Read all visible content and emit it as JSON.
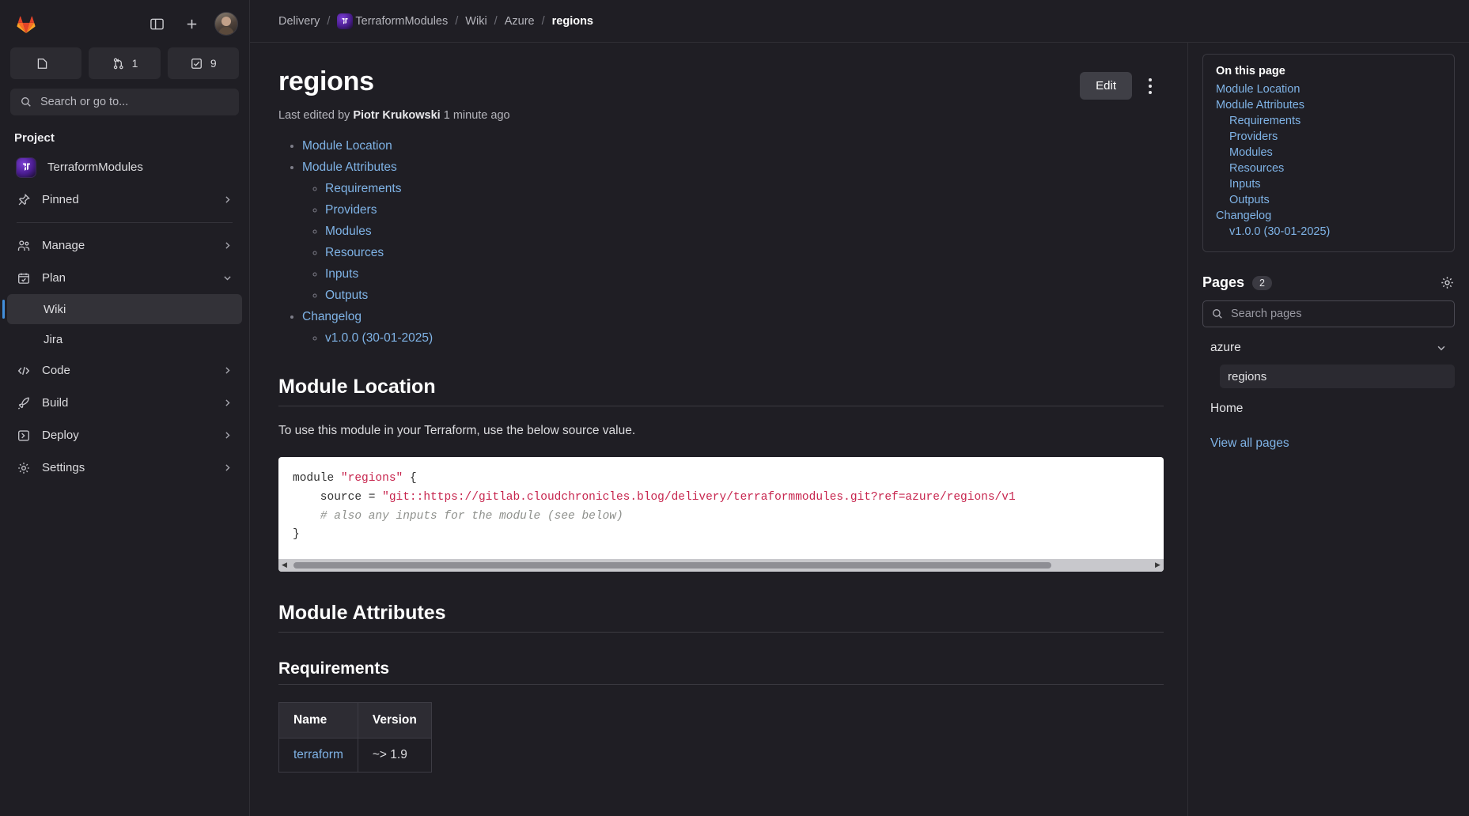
{
  "topbar": {
    "logo_icon": "gitlab-logo-icon",
    "sidebar_toggle_icon": "panel-toggle-icon",
    "create_new_icon": "plus-icon",
    "avatar_name": "user-avatar",
    "counters": [
      {
        "icon": "issues-icon",
        "label": "",
        "name": "issues-counter"
      },
      {
        "icon": "merge-request-icon",
        "label": "1",
        "name": "merge-requests-counter"
      },
      {
        "icon": "todo-check-icon",
        "label": "9",
        "name": "todos-counter"
      }
    ],
    "search_placeholder": "Search or go to..."
  },
  "sidebar": {
    "heading": "Project",
    "project_name": "TerraformModules",
    "items": [
      {
        "label": "Pinned",
        "icon": "pin-icon",
        "chevron": "right"
      },
      {
        "label": "Manage",
        "icon": "users-icon",
        "chevron": "right"
      },
      {
        "label": "Plan",
        "icon": "calendar-icon",
        "chevron": "down"
      },
      {
        "label": "Code",
        "icon": "code-brackets-icon",
        "chevron": "right"
      },
      {
        "label": "Build",
        "icon": "rocket-icon",
        "chevron": "right"
      },
      {
        "label": "Deploy",
        "icon": "deploy-icon",
        "chevron": "right"
      },
      {
        "label": "Settings",
        "icon": "gear-icon",
        "chevron": "right"
      }
    ],
    "plan_children": [
      {
        "label": "Wiki",
        "active": true
      },
      {
        "label": "Jira",
        "active": false
      }
    ]
  },
  "breadcrumb": [
    {
      "label": "Delivery",
      "icon": null,
      "current": false
    },
    {
      "label": "TerraformModules",
      "icon": "project-avatar",
      "current": false
    },
    {
      "label": "Wiki",
      "icon": null,
      "current": false
    },
    {
      "label": "Azure",
      "icon": null,
      "current": false
    },
    {
      "label": "regions",
      "icon": null,
      "current": true
    }
  ],
  "page": {
    "title": "regions",
    "edit_label": "Edit",
    "more_actions_icon": "kebab-menu-icon",
    "last_edited_prefix": "Last edited by",
    "last_edited_author": "Piotr Krukowski",
    "last_edited_time": "1 minute ago"
  },
  "toc": [
    {
      "label": "Module Location",
      "children": []
    },
    {
      "label": "Module Attributes",
      "children": [
        {
          "label": "Requirements"
        },
        {
          "label": "Providers"
        },
        {
          "label": "Modules"
        },
        {
          "label": "Resources"
        },
        {
          "label": "Inputs"
        },
        {
          "label": "Outputs"
        }
      ]
    },
    {
      "label": "Changelog",
      "children": [
        {
          "label": "v1.0.0 (30-01-2025)"
        }
      ]
    }
  ],
  "sections": {
    "module_location_heading": "Module Location",
    "module_location_para": "To use this module in your Terraform, use the below source value.",
    "module_attributes_heading": "Module Attributes",
    "requirements_heading": "Requirements"
  },
  "code_block": {
    "line1_a": "module ",
    "line1_str": "\"regions\"",
    "line1_b": " {",
    "line2_a": "    source = ",
    "line2_str": "\"git::https://gitlab.cloudchronicles.blog/delivery/terraformmodules.git?ref=azure/regions/v1",
    "line3_comment": "    # also any inputs for the module (see below)",
    "line4": "}",
    "scroll_left_icon": "scroll-left-arrow-icon",
    "scroll_right_icon": "scroll-right-arrow-icon"
  },
  "requirements_table": {
    "headers": [
      "Name",
      "Version"
    ],
    "rows": [
      {
        "name": "terraform",
        "version": "~> 1.9"
      }
    ]
  },
  "right_rail": {
    "on_this_page_title": "On this page",
    "on_this_page_links": [
      {
        "label": "Module Location",
        "level": 1
      },
      {
        "label": "Module Attributes",
        "level": 1
      },
      {
        "label": "Requirements",
        "level": 2
      },
      {
        "label": "Providers",
        "level": 2
      },
      {
        "label": "Modules",
        "level": 2
      },
      {
        "label": "Resources",
        "level": 2
      },
      {
        "label": "Inputs",
        "level": 2
      },
      {
        "label": "Outputs",
        "level": 2
      },
      {
        "label": "Changelog",
        "level": 1
      },
      {
        "label": "v1.0.0 (30-01-2025)",
        "level": 2
      }
    ],
    "pages_title": "Pages",
    "pages_count": "2",
    "pages_settings_icon": "gear-icon",
    "pages_search_placeholder": "Search pages",
    "tree": [
      {
        "label": "azure",
        "type": "folder",
        "expanded": true,
        "children": [
          {
            "label": "regions",
            "selected": true
          }
        ]
      },
      {
        "label": "Home",
        "type": "page"
      }
    ],
    "view_all_label": "View all pages"
  },
  "colors": {
    "accent_blue": "#428fdc",
    "link_blue": "#7fb3e6",
    "bg": "#1f1e24",
    "code_string": "#c7254e"
  }
}
